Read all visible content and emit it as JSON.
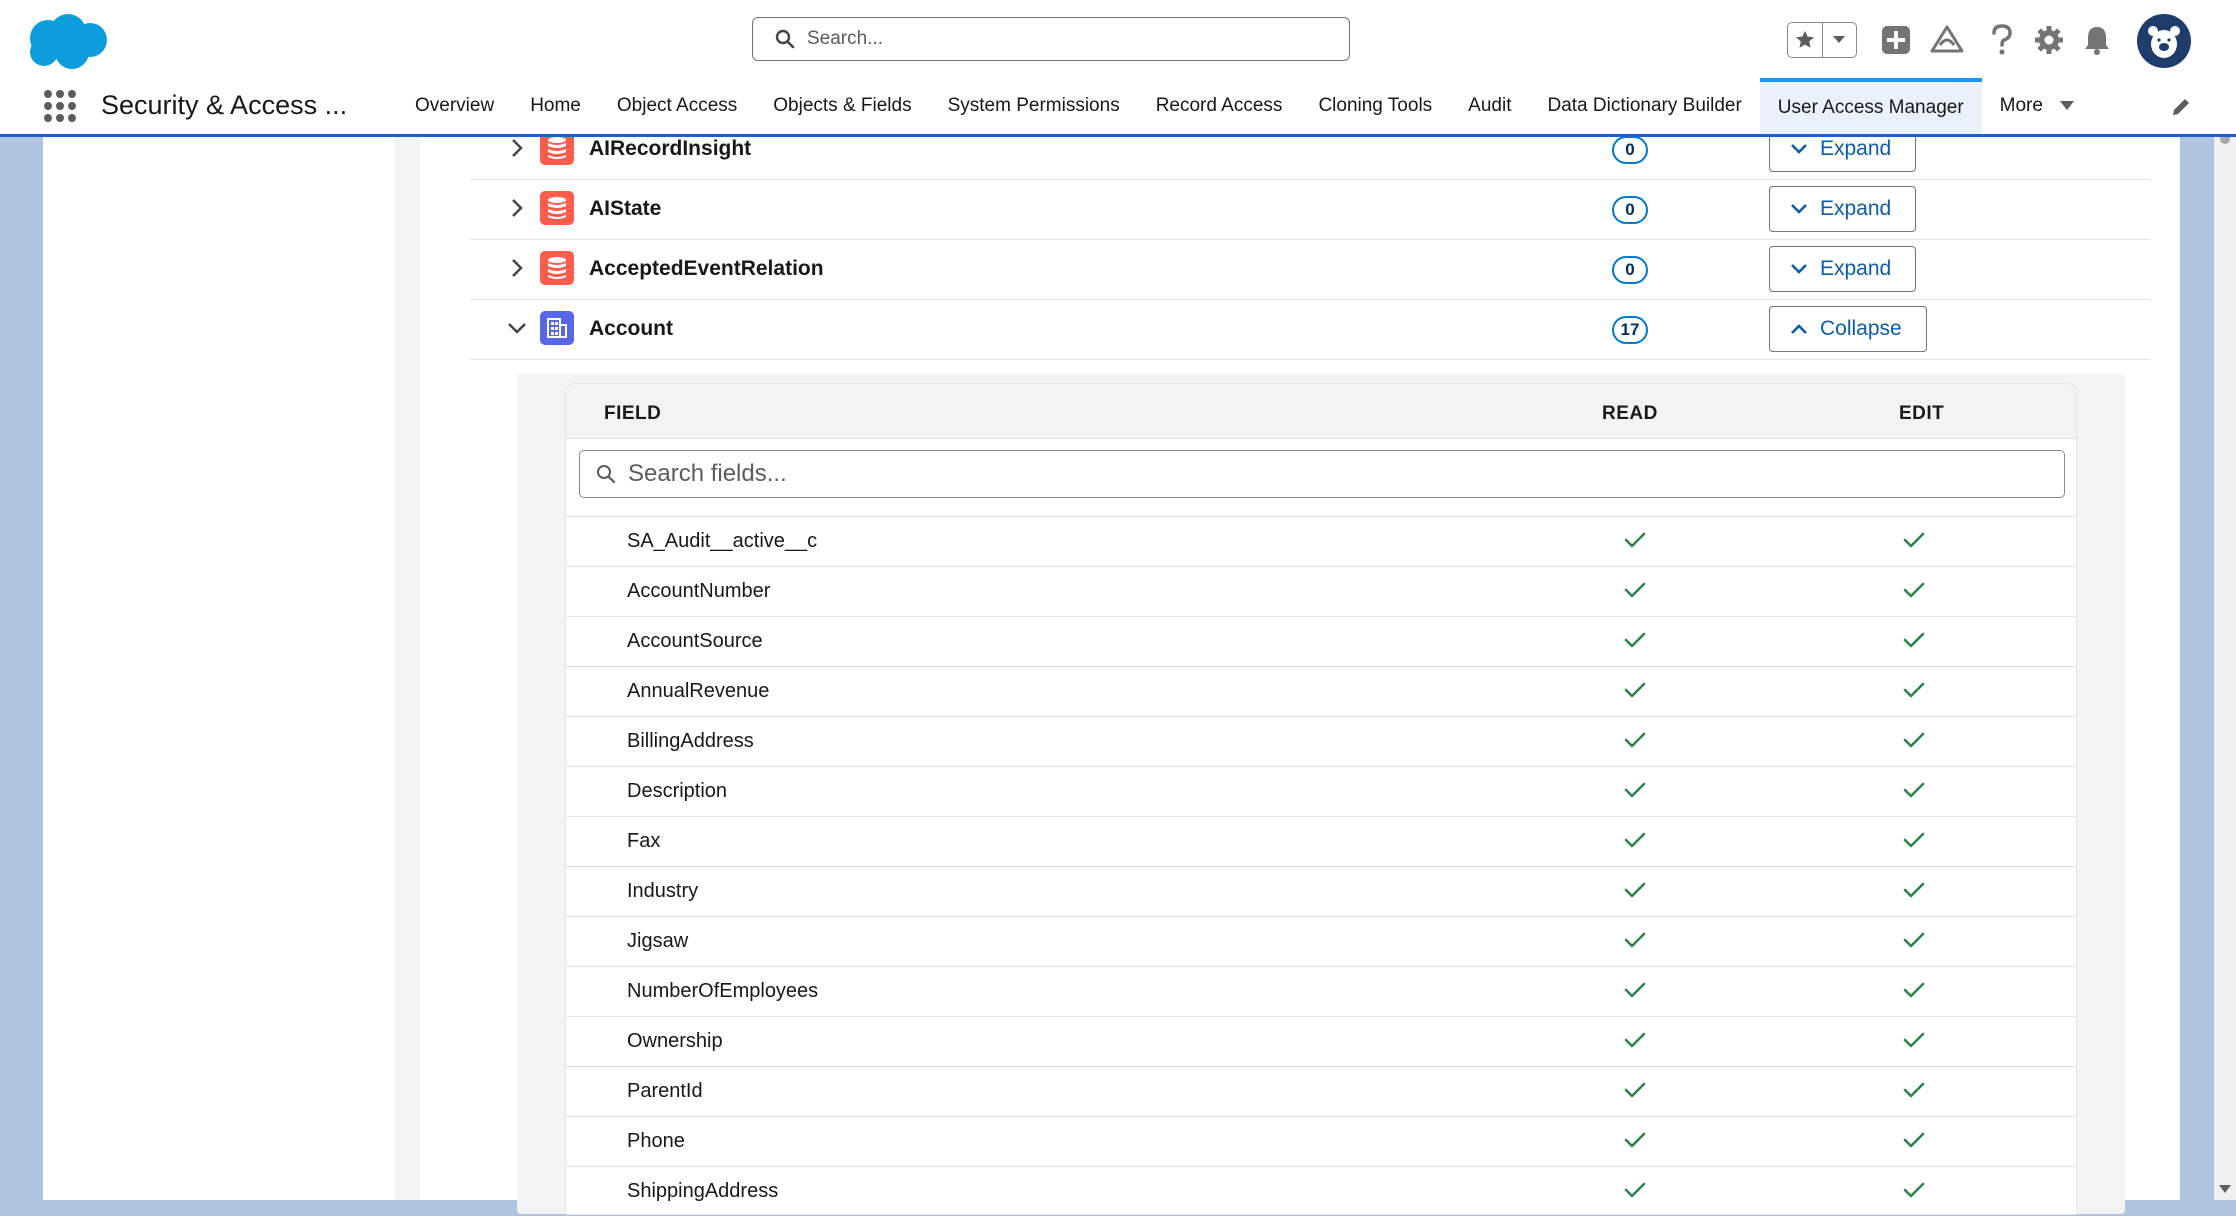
{
  "header": {
    "search_placeholder": "Search...",
    "app_name": "Security & Access ...",
    "nav_tabs": [
      {
        "label": "Overview"
      },
      {
        "label": "Home"
      },
      {
        "label": "Object Access"
      },
      {
        "label": "Objects & Fields"
      },
      {
        "label": "System Permissions"
      },
      {
        "label": "Record Access"
      },
      {
        "label": "Cloning Tools"
      },
      {
        "label": "Audit"
      },
      {
        "label": "Data Dictionary Builder"
      },
      {
        "label": "User Access Manager",
        "active": true
      }
    ],
    "more_label": "More",
    "icons": [
      "salesforce-cloud-logo",
      "star-icon",
      "chevron-down-icon",
      "add-icon",
      "trailhead-icon",
      "help-icon",
      "gear-icon",
      "bell-icon",
      "avatar",
      "app-launcher-icon",
      "pencil-icon"
    ]
  },
  "objects": [
    {
      "name": "AIRecordInsight",
      "count": "0",
      "action": "Expand",
      "expanded": false,
      "icon": "database-icon",
      "icon_color": "#fe5c4c"
    },
    {
      "name": "AIState",
      "count": "0",
      "action": "Expand",
      "expanded": false,
      "icon": "database-icon",
      "icon_color": "#fe5c4c"
    },
    {
      "name": "AcceptedEventRelation",
      "count": "0",
      "action": "Expand",
      "expanded": false,
      "icon": "database-icon",
      "icon_color": "#fe5c4c"
    },
    {
      "name": "Account",
      "count": "17",
      "action": "Collapse",
      "expanded": true,
      "icon": "account-icon",
      "icon_color": "#5867e8"
    }
  ],
  "field_table": {
    "headers": {
      "field": "FIELD",
      "read": "READ",
      "edit": "EDIT"
    },
    "search_placeholder": "Search fields...",
    "rows": [
      {
        "field": "SA_Audit__active__c",
        "read": true,
        "edit": true
      },
      {
        "field": "AccountNumber",
        "read": true,
        "edit": true
      },
      {
        "field": "AccountSource",
        "read": true,
        "edit": true
      },
      {
        "field": "AnnualRevenue",
        "read": true,
        "edit": true
      },
      {
        "field": "BillingAddress",
        "read": true,
        "edit": true
      },
      {
        "field": "Description",
        "read": true,
        "edit": true
      },
      {
        "field": "Fax",
        "read": true,
        "edit": true
      },
      {
        "field": "Industry",
        "read": true,
        "edit": true
      },
      {
        "field": "Jigsaw",
        "read": true,
        "edit": true
      },
      {
        "field": "NumberOfEmployees",
        "read": true,
        "edit": true
      },
      {
        "field": "Ownership",
        "read": true,
        "edit": true
      },
      {
        "field": "ParentId",
        "read": true,
        "edit": true
      },
      {
        "field": "Phone",
        "read": true,
        "edit": true
      },
      {
        "field": "ShippingAddress",
        "read": true,
        "edit": true
      }
    ]
  },
  "colors": {
    "brand": "#0176d3",
    "check": "#2e844a",
    "link": "#0b5cab",
    "active_tab_bg": "#eaf1fb"
  }
}
